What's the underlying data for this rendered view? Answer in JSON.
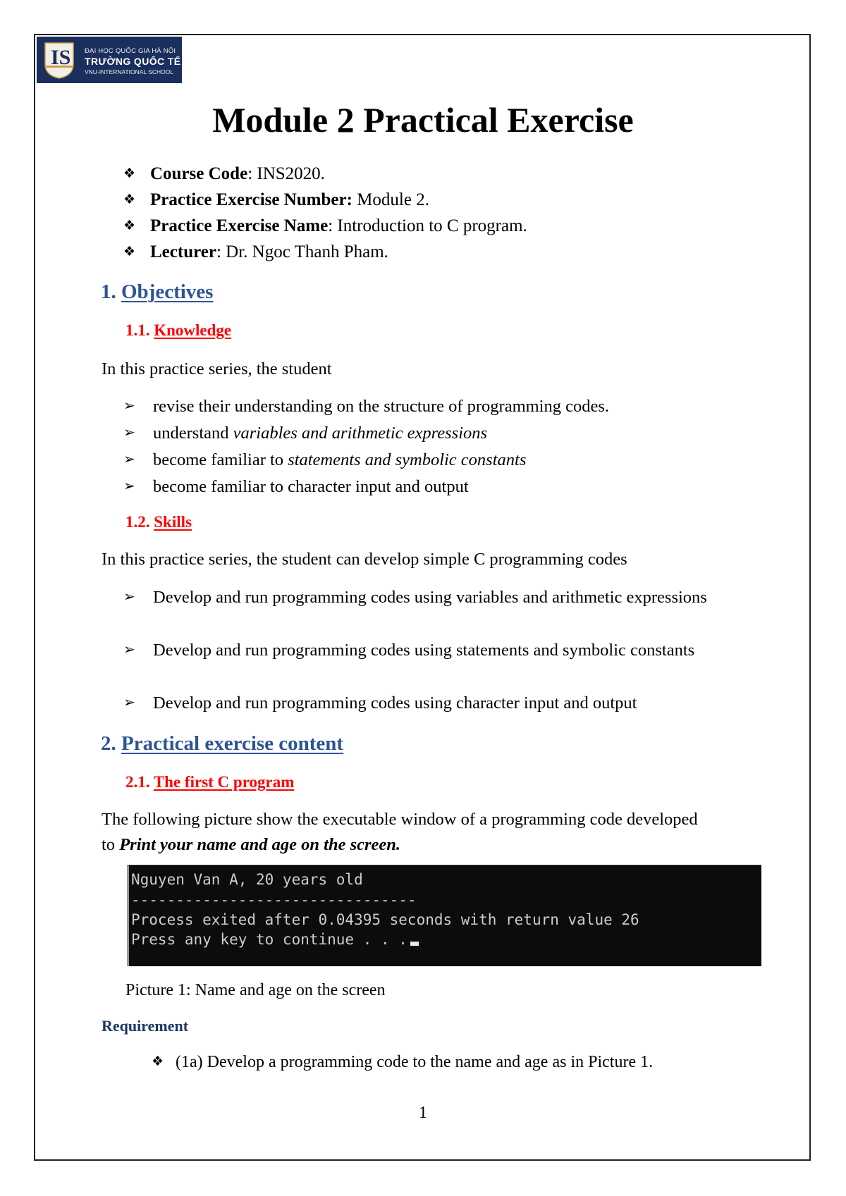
{
  "logo": {
    "line1": "ĐẠI HỌC QUỐC GIA HÀ NỘI",
    "line2": "TRƯỜNG QUỐC TẾ",
    "line3": "VNU-INTERNATIONAL SCHOOL",
    "monogram": "IS",
    "brand_color": "#1b2f5e"
  },
  "title": "Module 2 Practical Exercise",
  "meta": [
    {
      "bullet": "diamond-bullet-icon",
      "label": "Course Code",
      "sep": ": ",
      "value": "INS2020."
    },
    {
      "bullet": "diamond-bullet-icon",
      "label": "Practice Exercise Number:",
      "sep": " ",
      "value": "Module 2."
    },
    {
      "bullet": "diamond-bullet-icon",
      "label": "Practice Exercise Name",
      "sep": ": ",
      "value": "Introduction to C program."
    },
    {
      "bullet": "diamond-bullet-icon",
      "label": "Lecturer",
      "sep": ": ",
      "value": "Dr. Ngoc Thanh Pham."
    }
  ],
  "sections": {
    "objectives": {
      "number": "1. ",
      "title": "Objectives",
      "knowledge": {
        "number": "1.1. ",
        "title": "Knowledge",
        "intro": "In this practice series, the student",
        "items": [
          {
            "plain": "revise their understanding on the structure of  programming codes.",
            "italic": ""
          },
          {
            "plain": "understand ",
            "italic": "variables and arithmetic expressions"
          },
          {
            "plain": "become familiar to ",
            "italic": "statements and symbolic constants"
          },
          {
            "plain": "become familiar to character input and output",
            "italic": ""
          }
        ]
      },
      "skills": {
        "number": "1.2. ",
        "title": "Skills",
        "intro": "In this practice series, the student can develop simple C programming codes",
        "items": [
          "Develop and run programming codes using variables and arithmetic expressions",
          "Develop and run programming codes using statements and symbolic constants",
          "Develop and run programming codes using character input and output"
        ]
      }
    },
    "content": {
      "number": "2. ",
      "title": "Practical exercise content",
      "first_program": {
        "number": "2.1. ",
        "title": "The first C program",
        "intro_line1": "The following picture show the executable window of a programming code developed",
        "intro_line2_plain": "to ",
        "intro_line2_bold_italic": "Print your name and age on the screen.",
        "terminal": {
          "lines": [
            "Nguyen Van A, 20 years old",
            "--------------------------------",
            "Process exited after 0.04395 seconds with return value 26",
            "Press any key to continue . . ."
          ],
          "background": "#0c0c0c",
          "text_color": "#cccccc"
        },
        "caption": "Picture 1: Name and age on the screen",
        "requirement_heading": "Requirement",
        "requirements": [
          "(1a) Develop a programming code to  the name and age as in Picture 1."
        ]
      }
    }
  },
  "colors": {
    "heading1": "#2e5497",
    "heading2": "#ff0000",
    "requirement": "#1f3864"
  },
  "page_number": "1",
  "glyphs": {
    "diamond_bullet": "❖",
    "arrow_bullet": "➢"
  }
}
